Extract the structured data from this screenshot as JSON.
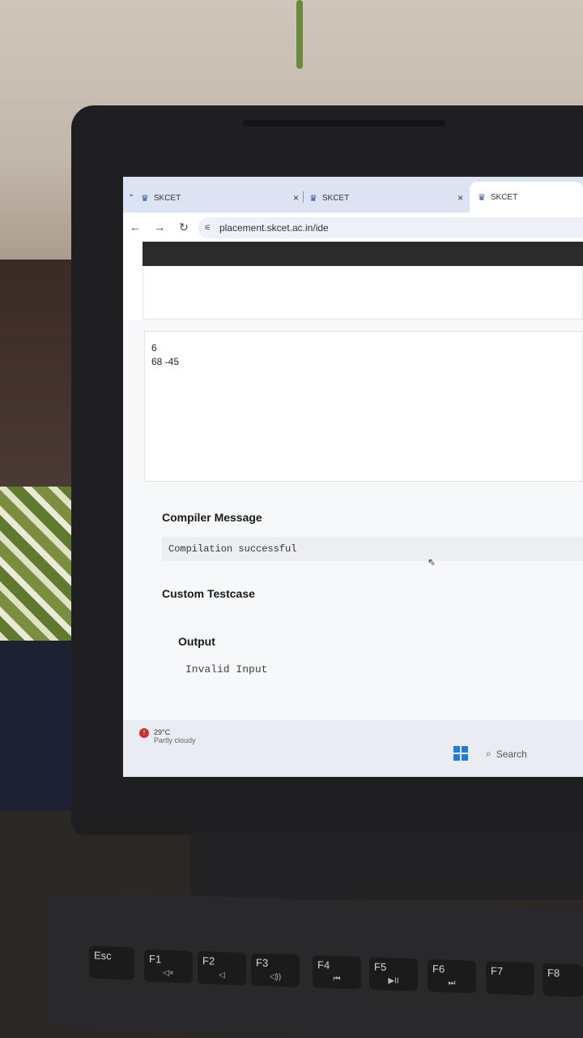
{
  "browser": {
    "tabs": [
      {
        "title": "SKCET"
      },
      {
        "title": "SKCET"
      },
      {
        "title": "SKCET"
      }
    ],
    "url": "placement.skcet.ac.in/ide"
  },
  "ide": {
    "input_lines": [
      "6",
      "68 -45"
    ],
    "compiler_message_title": "Compiler Message",
    "compiler_message": "Compilation successful",
    "custom_testcase_label": "Custom Testcase",
    "output_title": "Output",
    "output_text": "Invalid Input"
  },
  "taskbar": {
    "temperature": "29°C",
    "weather": "Partly cloudy",
    "search_placeholder": "Search"
  },
  "keyboard": {
    "keys": [
      "Esc",
      "F1",
      "F2",
      "F3",
      "F4",
      "F5",
      "F6",
      "F7",
      "F8"
    ]
  }
}
